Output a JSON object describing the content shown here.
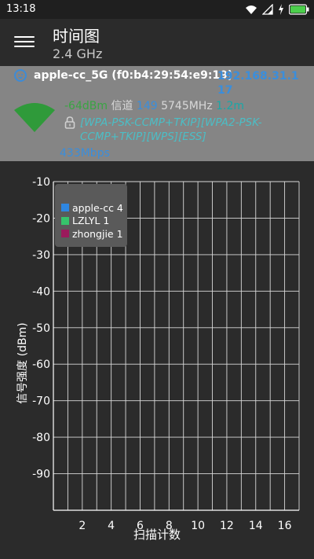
{
  "status": {
    "time": "13:18"
  },
  "appbar": {
    "title": "时间图",
    "subtitle": "2.4 GHz"
  },
  "ap": {
    "ssid": "apple-cc_5G (f0:b4:29:54:e9:19)",
    "ip": "192.168.31.117",
    "signal": "-64dBm",
    "channel_label": "信道",
    "channel": "149",
    "frequency": "5745MHz",
    "distance": "1.2m",
    "capabilities": "[WPA-PSK-CCMP+TKIP][WPA2-PSK-CCMP+TKIP][WPS][ESS]",
    "speed": "433Mbps"
  },
  "colors": {
    "accent": "#3a8edc",
    "signal": "#3aa443",
    "panel": "#858585",
    "background": "#2b2b2b"
  },
  "legend": [
    {
      "label": "apple-cc 4",
      "color": "#2e86e0"
    },
    {
      "label": "LZLYL 1",
      "color": "#36c46b"
    },
    {
      "label": "zhongjie 1",
      "color": "#9b1a5c"
    }
  ],
  "chart_data": {
    "type": "line",
    "ylabel": "信号强度 (dBm)",
    "xlabel": "扫描计数",
    "ylim": [
      -100,
      -10
    ],
    "xlim": [
      0,
      17
    ],
    "yticks": [
      -10,
      -20,
      -30,
      -40,
      -50,
      -60,
      -70,
      -80,
      -90
    ],
    "xticks": [
      2,
      4,
      6,
      8,
      10,
      12,
      14,
      16
    ],
    "grid": true,
    "legend_position": "top-left",
    "series": [
      {
        "name": "apple-cc 4",
        "values": []
      },
      {
        "name": "LZLYL 1",
        "values": []
      },
      {
        "name": "zhongjie 1",
        "values": []
      }
    ]
  }
}
